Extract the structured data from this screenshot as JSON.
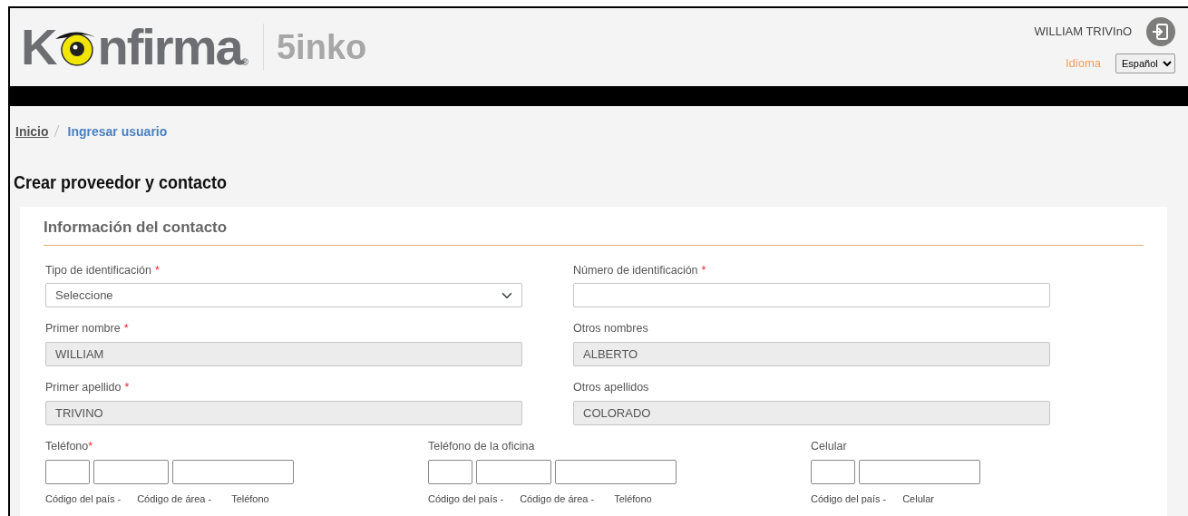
{
  "header": {
    "logo": {
      "before": "K",
      "after": "nfirma",
      "registered": "®"
    },
    "product": "5inko",
    "user": "WILLIAM TRIVInO",
    "language_label": "Idioma",
    "language": "Español"
  },
  "breadcrumb": [
    {
      "label": "Inicio",
      "selected": false
    },
    {
      "label": "Ingresar usuario",
      "selected": true
    }
  ],
  "title": "Crear proveedor y contacto",
  "section": {
    "title": "Información del contacto",
    "required_mark": "*",
    "fields": [
      {
        "label": "Tipo de identificación",
        "required": true,
        "kind": "select",
        "value": "Seleccione",
        "disabled": false
      },
      {
        "label": "Número de identificación",
        "required": true,
        "kind": "text",
        "disabled": false
      },
      {
        "label": "Primer nombre",
        "required": true,
        "kind": "text",
        "value": "WILLIAM",
        "disabled": true
      },
      {
        "label": "Otros nombres",
        "required": false,
        "kind": "text",
        "value": "ALBERTO",
        "disabled": true
      },
      {
        "label": "Primer apellido",
        "required": true,
        "kind": "text",
        "value": "TRIVINO",
        "disabled": true
      },
      {
        "label": "Otros apellidos",
        "required": false,
        "kind": "text",
        "value": "COLORADO",
        "disabled": true
      }
    ],
    "phones": [
      {
        "label": "Teléfono",
        "required": true,
        "parts": [
          {
            "kind": "country",
            "caption": "Código del país -"
          },
          {
            "kind": "area",
            "caption": "Código de área -"
          },
          {
            "kind": "number",
            "caption": "Teléfono"
          }
        ]
      },
      {
        "label": "Teléfono de la oficina",
        "required": false,
        "parts": [
          {
            "kind": "country",
            "caption": "Código del país -"
          },
          {
            "kind": "area",
            "caption": "Código de área -"
          },
          {
            "kind": "number",
            "caption": "Teléfono"
          }
        ]
      },
      {
        "label": "Celular",
        "required": false,
        "parts": [
          {
            "kind": "country",
            "caption": "Código del país -"
          },
          {
            "kind": "number",
            "caption": "Celular"
          }
        ]
      }
    ]
  }
}
